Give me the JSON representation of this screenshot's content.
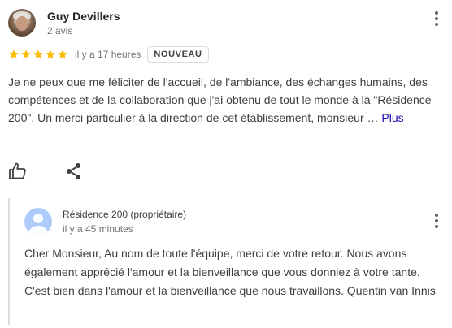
{
  "review": {
    "author": {
      "name": "Guy Devillers",
      "meta": "2 avis"
    },
    "rating": {
      "stars": 5,
      "max": 5,
      "color": "#fbbc04"
    },
    "time": "il y a 17 heures",
    "badge": "NOUVEAU",
    "text": "Je ne peux que me féliciter de l'accueil, de l'ambiance, des échanges humains, des compétences et de la collaboration que j'ai obtenu de tout le monde à la \"Résidence 200\". Un merci particulier à la direction de cet établissement, monsieur …",
    "more_label": "Plus",
    "actions": {
      "like_icon": "thumb-up-icon",
      "share_icon": "share-icon"
    }
  },
  "owner_reply": {
    "name": "Résidence 200 (propriétaire)",
    "time": "il y a 45 minutes",
    "text": "Cher Monsieur, Au nom de toute l'équipe, merci de votre retour. Nous avons également apprécié l'amour et la bienveillance que vous donniez à votre tante. C'est bien dans l'amour et la bienveillance que nous travaillons. Quentin van Innis"
  },
  "colors": {
    "link": "#1a0dab",
    "muted": "#70757a",
    "owner_avatar": "#aecbfa"
  }
}
